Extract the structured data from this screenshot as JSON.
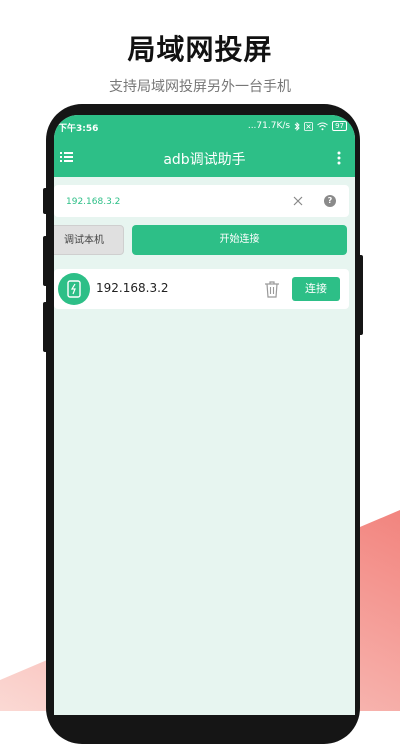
{
  "promo": {
    "headline": "局域网投屏",
    "subline": "支持局域网投屏另外一台手机"
  },
  "status_bar": {
    "time": "下午3:56",
    "network_speed": "...71.7K/s",
    "battery": "97"
  },
  "app_bar": {
    "title": "adb调试助手"
  },
  "search": {
    "value": "192.168.3.2",
    "help_glyph": "?"
  },
  "actions": {
    "debug_local_label": "调试本机",
    "start_connect_label": "开始连接"
  },
  "devices": [
    {
      "ip": "192.168.3.2",
      "connect_label": "连接"
    }
  ],
  "colors": {
    "accent": "#2dbf87",
    "screen_bg": "#e7f5f0",
    "promo_gradient": "#f2847e"
  }
}
